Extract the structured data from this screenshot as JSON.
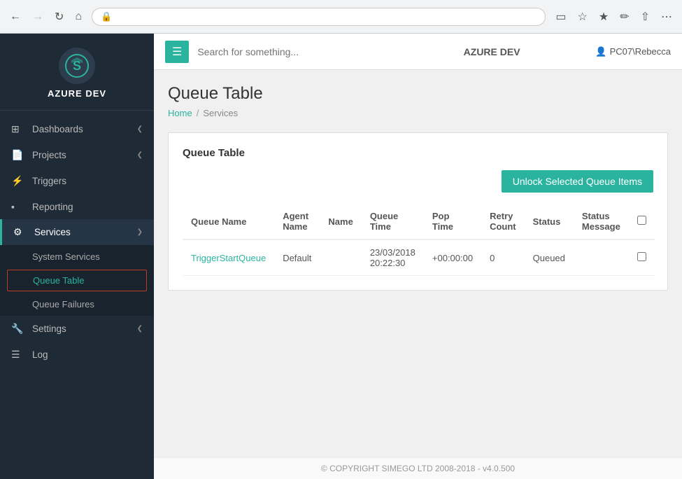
{
  "browser": {
    "address_placeholder": "🔒",
    "address_text": ""
  },
  "topbar": {
    "menu_icon": "☰",
    "search_placeholder": "Search for something...",
    "app_name": "AZURE DEV",
    "user": "PC07\\Rebecca"
  },
  "sidebar": {
    "logo_text": "AZURE DEV",
    "nav_items": [
      {
        "id": "dashboards",
        "label": "Dashboards",
        "icon": "⊞",
        "has_arrow": true,
        "active": false
      },
      {
        "id": "projects",
        "label": "Projects",
        "icon": "📁",
        "has_arrow": true,
        "active": false
      },
      {
        "id": "triggers",
        "label": "Triggers",
        "icon": "⚡",
        "has_arrow": false,
        "active": false
      },
      {
        "id": "reporting",
        "label": "Reporting",
        "icon": "📊",
        "has_arrow": false,
        "active": false
      },
      {
        "id": "services",
        "label": "Services",
        "icon": "⚙",
        "has_arrow": true,
        "active": true
      }
    ],
    "sub_nav": {
      "parent": "services",
      "items": [
        {
          "id": "system-services",
          "label": "System Services",
          "active": false
        },
        {
          "id": "queue-table",
          "label": "Queue Table",
          "active": true
        },
        {
          "id": "queue-failures",
          "label": "Queue Failures",
          "active": false
        }
      ]
    },
    "bottom_nav": [
      {
        "id": "settings",
        "label": "Settings",
        "icon": "🔧",
        "has_arrow": true
      },
      {
        "id": "log",
        "label": "Log",
        "icon": "☰",
        "has_arrow": false
      }
    ]
  },
  "page": {
    "title": "Queue Table",
    "breadcrumb": {
      "home": "Home",
      "separator": "/",
      "current": "Services"
    }
  },
  "card": {
    "title": "Queue Table",
    "unlock_btn_label": "Unlock Selected Queue Items",
    "table": {
      "columns": [
        {
          "id": "queue-name",
          "label": "Queue Name"
        },
        {
          "id": "agent-name",
          "label": "Agent Name"
        },
        {
          "id": "name",
          "label": "Name"
        },
        {
          "id": "queue-time",
          "label": "Queue Time"
        },
        {
          "id": "pop-time",
          "label": "Pop Time"
        },
        {
          "id": "retry-count",
          "label": "Retry Count"
        },
        {
          "id": "status",
          "label": "Status"
        },
        {
          "id": "status-message",
          "label": "Status Message"
        },
        {
          "id": "select",
          "label": ""
        }
      ],
      "rows": [
        {
          "queue_name": "TriggerStartQueue",
          "agent_name": "Default",
          "name": "",
          "queue_time": "23/03/2018 20:22:30",
          "pop_time": "+00:00:00",
          "retry_count": "0",
          "status": "Queued",
          "status_message": ""
        }
      ]
    }
  },
  "footer": {
    "copyright": "© COPYRIGHT SIMEGO LTD 2008-2018 - v4.0.500"
  }
}
